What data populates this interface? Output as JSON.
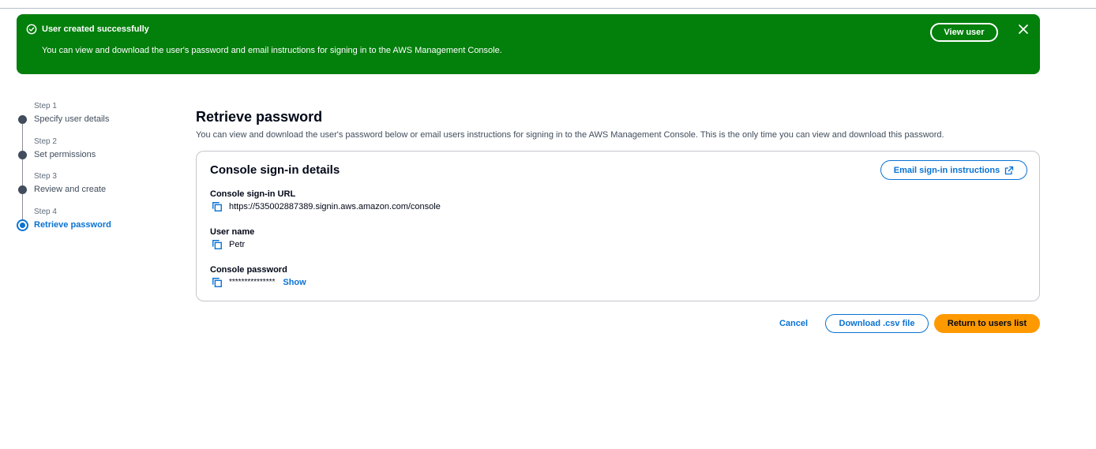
{
  "flash": {
    "title": "User created successfully",
    "message": "You can view and download the user's password and email instructions for signing in to the AWS Management Console.",
    "view_user_label": "View user",
    "status_icon": "success-check-circle-icon",
    "close_icon": "close-icon",
    "background": "#037f0c"
  },
  "steps": [
    {
      "number": "Step 1",
      "label": "Specify user details",
      "state": "completed"
    },
    {
      "number": "Step 2",
      "label": "Set permissions",
      "state": "completed"
    },
    {
      "number": "Step 3",
      "label": "Review and create",
      "state": "completed"
    },
    {
      "number": "Step 4",
      "label": "Retrieve password",
      "state": "current"
    }
  ],
  "main": {
    "title": "Retrieve password",
    "description": "You can view and download the user's password below or email users instructions for signing in to the AWS Management Console. This is the only time you can view and download this password."
  },
  "card": {
    "title": "Console sign-in details",
    "email_button_label": "Email sign-in instructions",
    "email_button_icon": "external-link-icon",
    "url_label": "Console sign-in URL",
    "url_value": "https://535002887389.signin.aws.amazon.com/console",
    "username_label": "User name",
    "username_value": "Petr",
    "password_label": "Console password",
    "password_mask": "***************",
    "show_label": "Show",
    "copy_icon": "copy-icon"
  },
  "actions": {
    "cancel_label": "Cancel",
    "download_label": "Download .csv file",
    "return_label": "Return to users list"
  },
  "colors": {
    "link_blue": "#0972d3",
    "primary_orange": "#ff9900",
    "success_green": "#037f0c"
  }
}
